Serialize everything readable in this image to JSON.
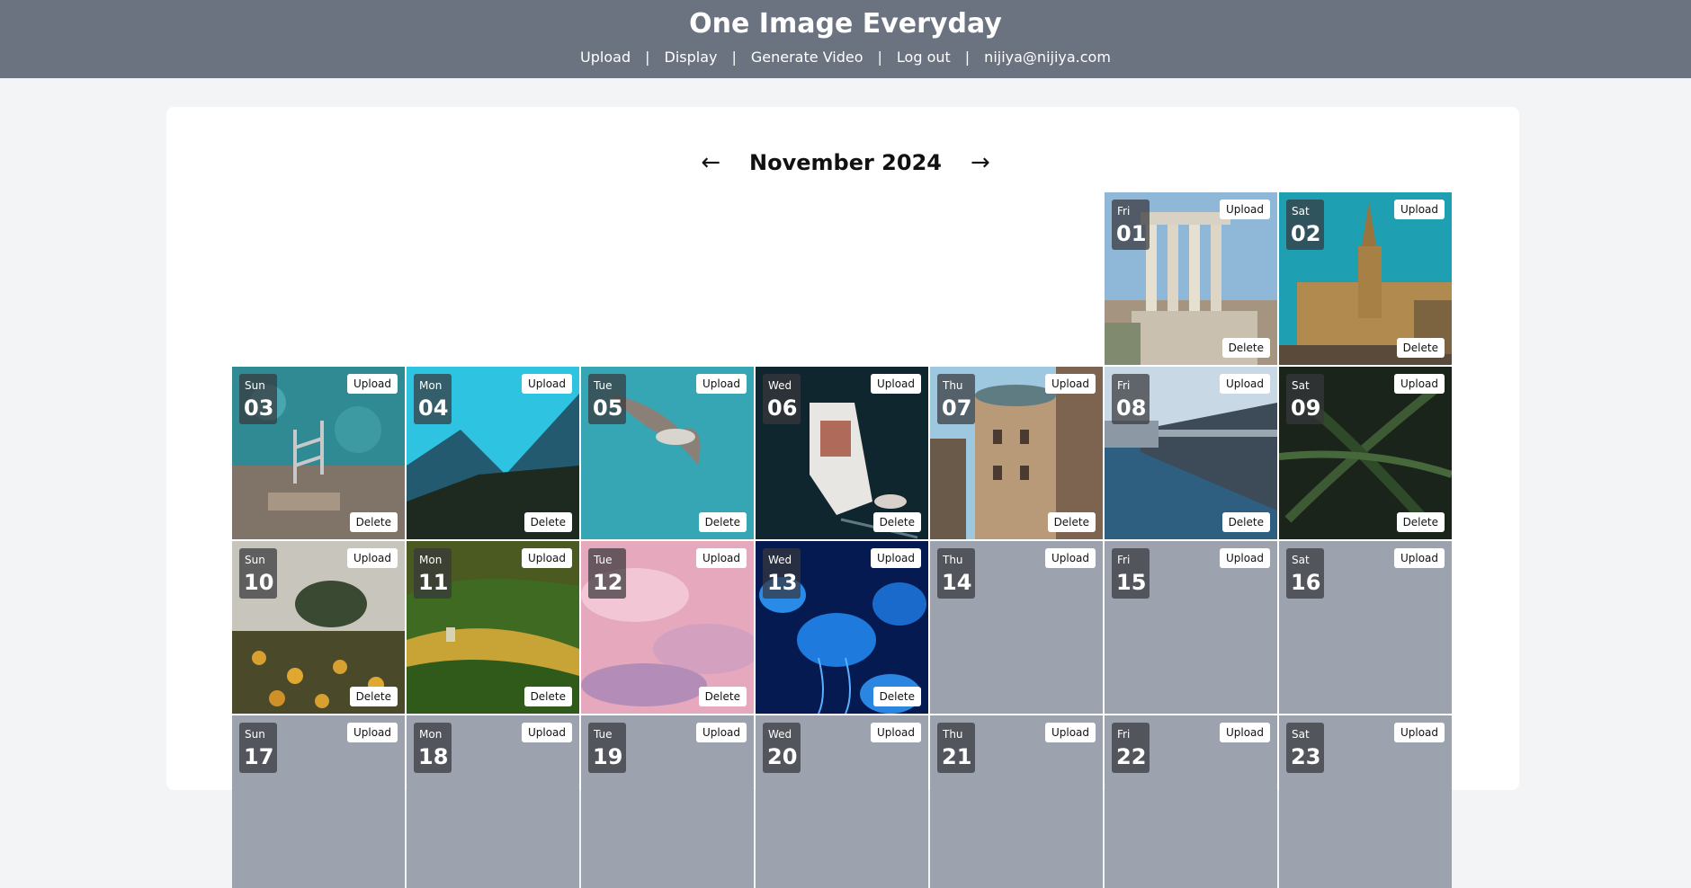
{
  "header": {
    "title": "One Image Everyday",
    "nav": {
      "upload": "Upload",
      "display": "Display",
      "generate_video": "Generate Video",
      "logout": "Log out",
      "separator": "|",
      "user_email": "nijiya@nijiya.com"
    }
  },
  "calendar": {
    "prev_arrow": "←",
    "next_arrow": "→",
    "month_label": "November 2024",
    "upload_label": "Upload",
    "delete_label": "Delete",
    "leading_blank_days": 5,
    "days": [
      {
        "dow": "Fri",
        "day": "01",
        "has_image": true,
        "image": "ancient-columns-ruins"
      },
      {
        "dow": "Sat",
        "day": "02",
        "has_image": true,
        "image": "gothic-town-hall"
      },
      {
        "dow": "Sun",
        "day": "03",
        "has_image": true,
        "image": "pool-ladder-in-sea"
      },
      {
        "dow": "Mon",
        "day": "04",
        "has_image": true,
        "image": "misty-mountains"
      },
      {
        "dow": "Tue",
        "day": "05",
        "has_image": true,
        "image": "seagull-flying"
      },
      {
        "dow": "Wed",
        "day": "06",
        "has_image": true,
        "image": "yacht-aerial"
      },
      {
        "dow": "Thu",
        "day": "07",
        "has_image": true,
        "image": "round-corner-building"
      },
      {
        "dow": "Fri",
        "day": "08",
        "has_image": true,
        "image": "bridge-over-water"
      },
      {
        "dow": "Sat",
        "day": "09",
        "has_image": true,
        "image": "fern-leaves"
      },
      {
        "dow": "Sun",
        "day": "10",
        "has_image": true,
        "image": "sunflower-field"
      },
      {
        "dow": "Mon",
        "day": "11",
        "has_image": true,
        "image": "rolling-green-hills"
      },
      {
        "dow": "Tue",
        "day": "12",
        "has_image": true,
        "image": "pink-clouds"
      },
      {
        "dow": "Wed",
        "day": "13",
        "has_image": true,
        "image": "blue-jellyfish"
      },
      {
        "dow": "Thu",
        "day": "14",
        "has_image": false
      },
      {
        "dow": "Fri",
        "day": "15",
        "has_image": false
      },
      {
        "dow": "Sat",
        "day": "16",
        "has_image": false
      },
      {
        "dow": "Sun",
        "day": "17",
        "has_image": false
      },
      {
        "dow": "Mon",
        "day": "18",
        "has_image": false
      },
      {
        "dow": "Tue",
        "day": "19",
        "has_image": false
      },
      {
        "dow": "Wed",
        "day": "20",
        "has_image": false
      },
      {
        "dow": "Thu",
        "day": "21",
        "has_image": false
      },
      {
        "dow": "Fri",
        "day": "22",
        "has_image": false
      },
      {
        "dow": "Sat",
        "day": "23",
        "has_image": false
      }
    ]
  },
  "colors": {
    "header_bg": "#6b7280",
    "page_bg": "#f3f4f6",
    "empty_cell_bg": "#9ca3af"
  }
}
